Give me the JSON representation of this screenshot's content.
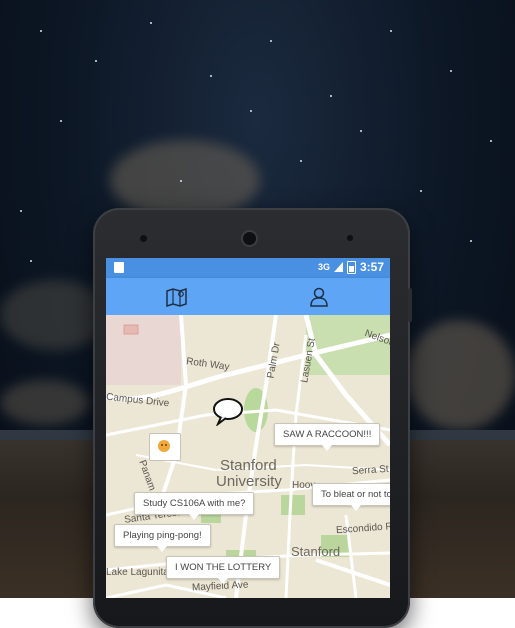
{
  "status_bar": {
    "signal": "3G",
    "time": "3:57"
  },
  "app_bar": {
    "tabs": [
      {
        "icon": "map-icon"
      },
      {
        "icon": "profile-icon"
      }
    ]
  },
  "map": {
    "labels": {
      "roth_way": "Roth Way",
      "campus_drive": "Campus Drive",
      "palm_dr": "Palm Dr",
      "lasuen_st": "Lasuen St",
      "nelson": "Nelson",
      "serra_st": "Serra St",
      "escondido_rd": "Escondido Rd",
      "hoover": "Hoov",
      "panama": "Panam",
      "santa_teresa": "Santa Teresa St",
      "mayfield_ave": "Mayfield Ave",
      "lake_lagunita": "Lake Lagunita",
      "stanford_university_1": "Stanford",
      "stanford_university_2": "University",
      "stanford_town": "Stanford"
    },
    "posts": [
      "SAW A RACCOON!!!",
      "To bleat or not to",
      "Study CS106A with me?",
      "Playing ping-pong!",
      "I WON THE LOTTERY"
    ]
  }
}
